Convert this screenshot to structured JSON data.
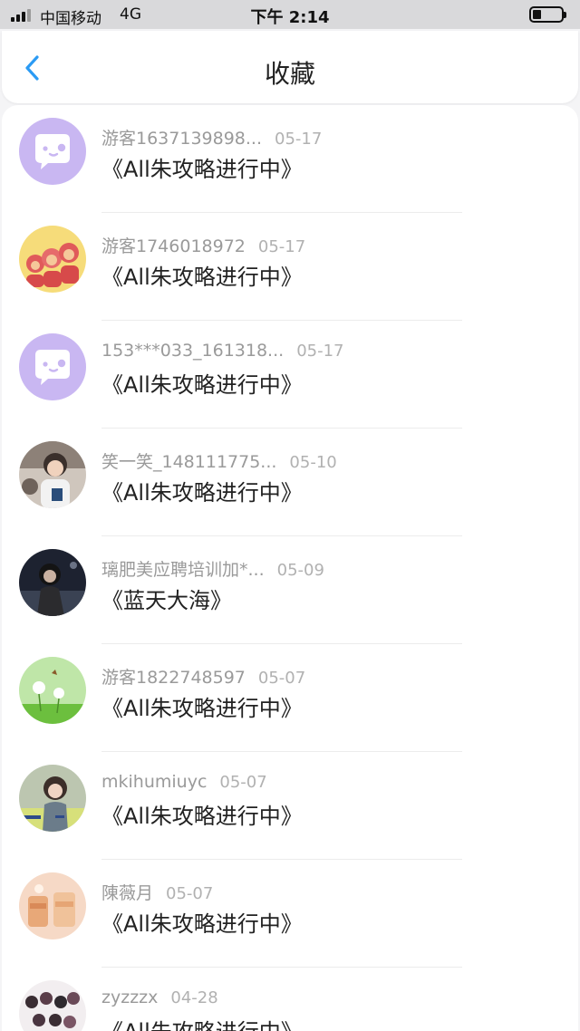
{
  "status_bar": {
    "carrier": "中国移动",
    "network": "4G",
    "time": "下午 2:14"
  },
  "header": {
    "title": "收藏"
  },
  "items": [
    {
      "user": "游客1637139898...",
      "date": "05-17",
      "title": "《All朱攻略进行中》",
      "avatar": "chat-bubble-purple"
    },
    {
      "user": "游客1746018972",
      "date": "05-17",
      "title": "《All朱攻略进行中》",
      "avatar": "cartoon-monkeys"
    },
    {
      "user": "153***033_161318...",
      "date": "05-17",
      "title": "《All朱攻略进行中》",
      "avatar": "chat-bubble-purple"
    },
    {
      "user": "笑一笑_148111775...",
      "date": "05-10",
      "title": "《All朱攻略进行中》",
      "avatar": "photo-person"
    },
    {
      "user": "璃肥美应聘培训加*...",
      "date": "05-09",
      "title": "《蓝天大海》",
      "avatar": "photo-dark-portrait"
    },
    {
      "user": "游客1822748597",
      "date": "05-07",
      "title": "《All朱攻略进行中》",
      "avatar": "dandelion-meadow"
    },
    {
      "user": "mkihumiuyc",
      "date": "05-07",
      "title": "《All朱攻略进行中》",
      "avatar": "photo-girl-text"
    },
    {
      "user": "陳薇月",
      "date": "05-07",
      "title": "《All朱攻略进行中》",
      "avatar": "photo-warm-drinks"
    },
    {
      "user": "zyzzzx",
      "date": "04-28",
      "title": "《All朱攻略进行中》",
      "avatar": "photo-group-anime"
    }
  ],
  "colors": {
    "accent": "#2b9bf4",
    "bubble": "#c9b7f2"
  }
}
